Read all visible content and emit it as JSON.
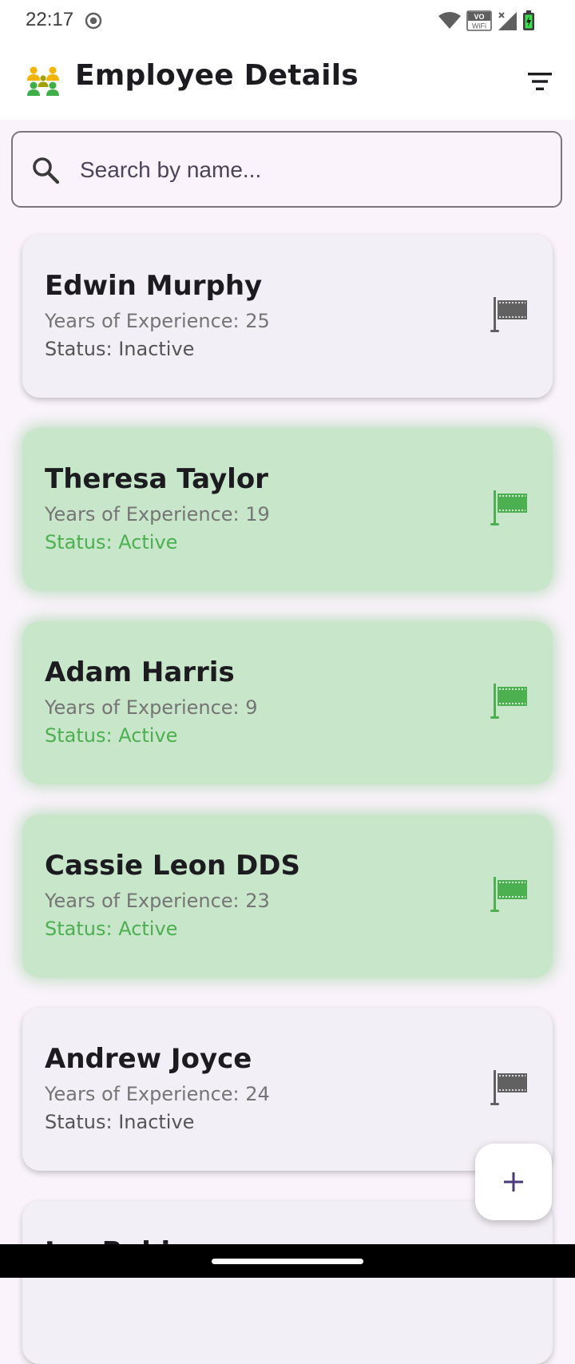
{
  "status_bar": {
    "time": "22:17",
    "wifi_badge_top": "VO",
    "wifi_badge_bottom": "WiFi"
  },
  "app_bar": {
    "title": "Employee Details",
    "logo_icon": "people-group-icon",
    "filter_icon": "filter-list-icon"
  },
  "search": {
    "placeholder": "Search by name...",
    "value": ""
  },
  "employees": [
    {
      "name": "Edwin Murphy",
      "experience": "Years of Experience: 25",
      "status": "Status: Inactive",
      "active": false
    },
    {
      "name": "Theresa Taylor",
      "experience": "Years of Experience: 19",
      "status": "Status: Active",
      "active": true
    },
    {
      "name": "Adam Harris",
      "experience": "Years of Experience: 9",
      "status": "Status: Active",
      "active": true
    },
    {
      "name": "Cassie Leon DDS",
      "experience": "Years of Experience: 23",
      "status": "Status: Active",
      "active": true
    },
    {
      "name": "Andrew Joyce",
      "experience": "Years of Experience: 24",
      "status": "Status: Inactive",
      "active": false
    },
    {
      "name": "Ian Robinson",
      "experience": "",
      "status": "",
      "active": false
    }
  ],
  "fab": {
    "icon": "plus-icon"
  },
  "colors": {
    "background": "#faf3fb",
    "active_card": "#c8e6c9",
    "active_accent": "#4caf50",
    "inactive_card": "#f3eff6",
    "inactive_flag": "#616161",
    "fab_icon": "#4a3880"
  }
}
